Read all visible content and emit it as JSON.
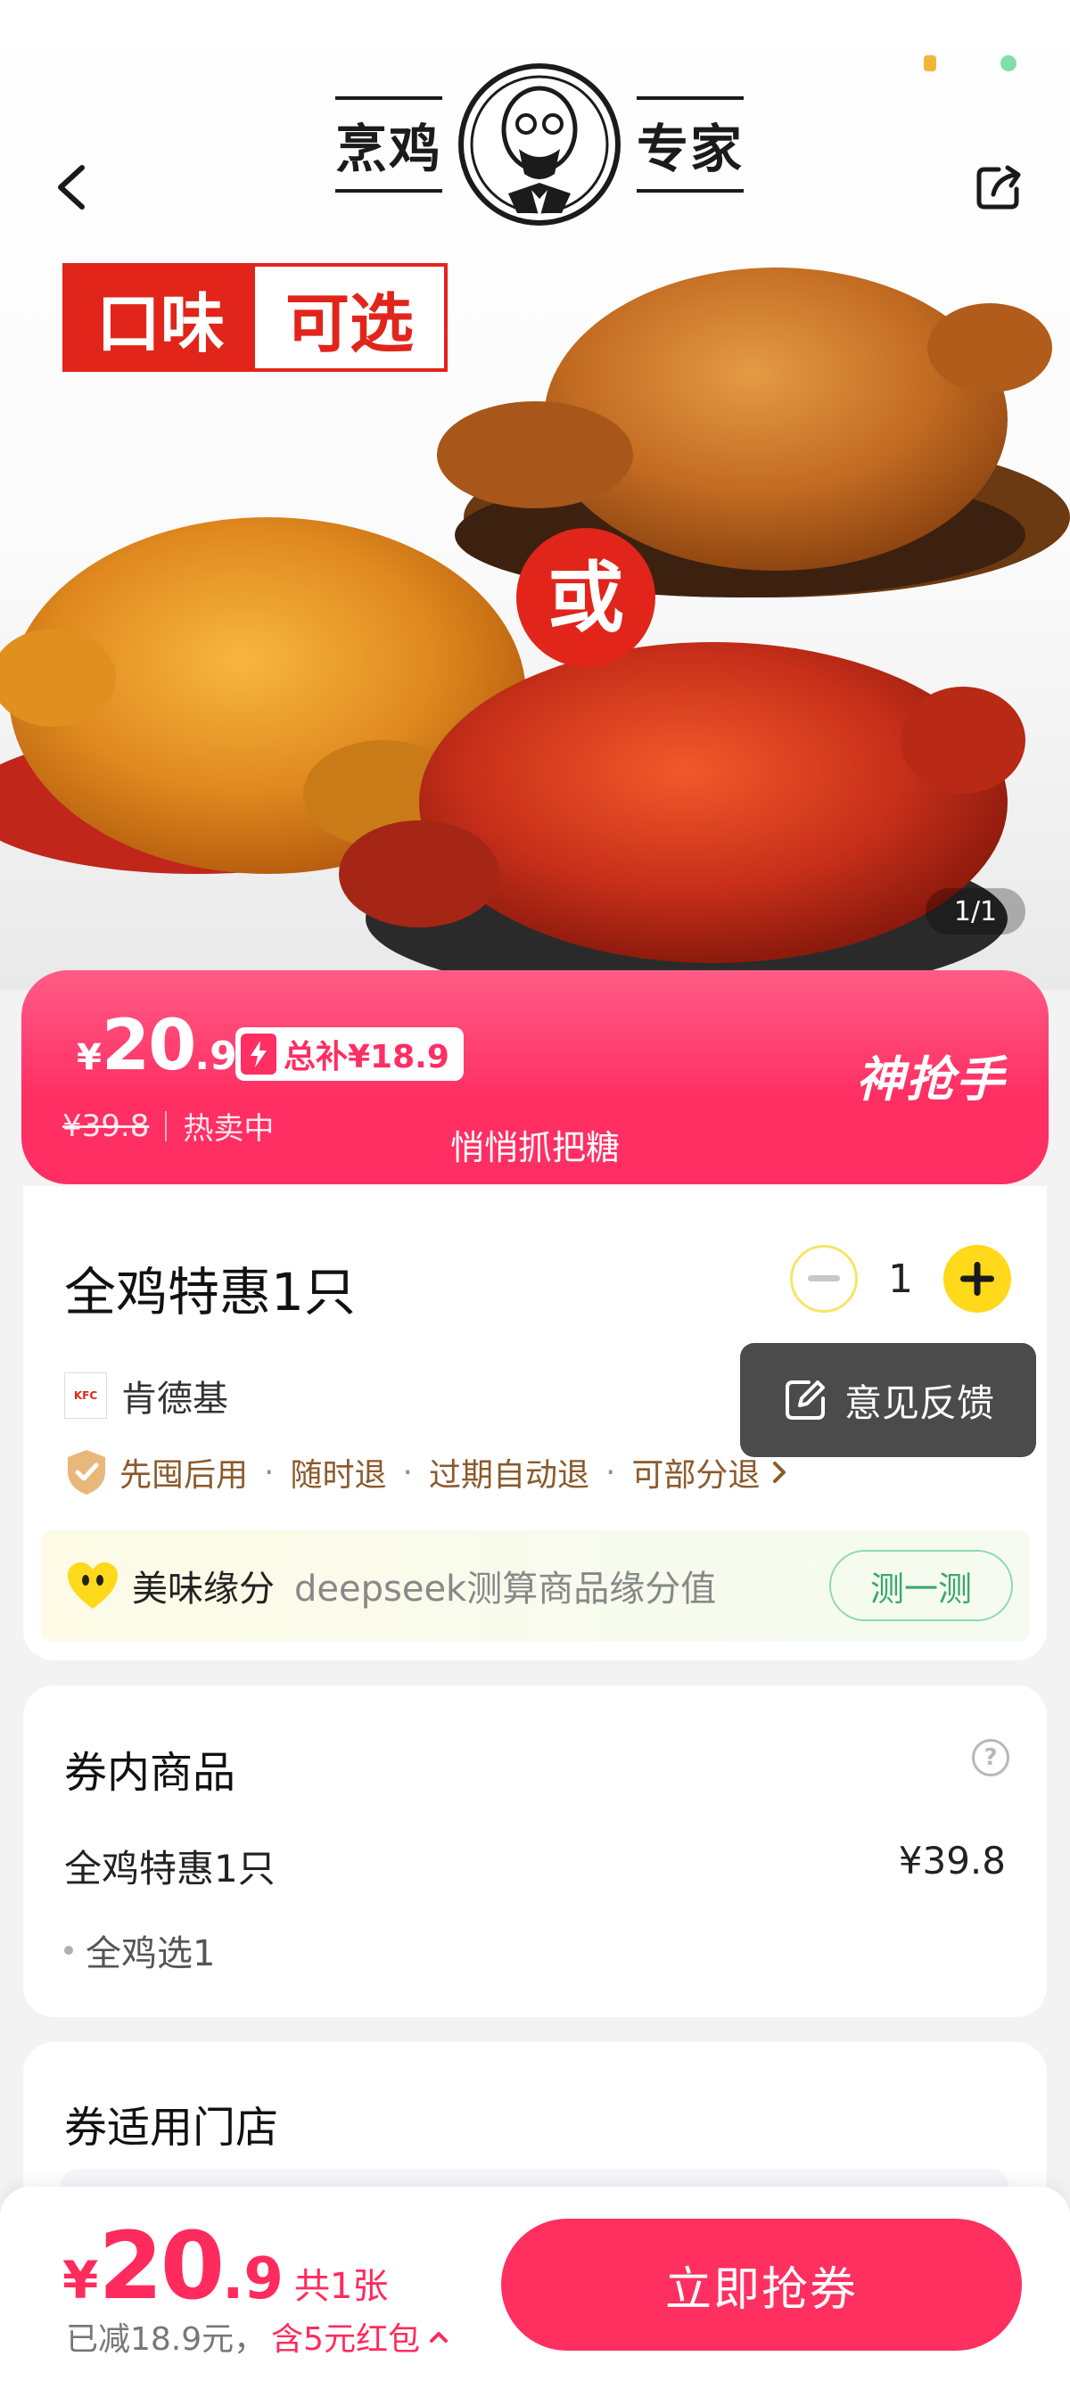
{
  "header": {
    "logo_left_text": "烹鸡",
    "logo_right_text": "专家",
    "flavor_tag": [
      "口味",
      "可选"
    ],
    "or_label": "或",
    "page_counter": "1/1"
  },
  "promo": {
    "currency": "¥",
    "price_int": "20",
    "price_dec": ".9",
    "subsidy": "总补¥18.9",
    "original_price": "¥39.8",
    "status": "热卖中",
    "slogan": "悄悄抓把糖",
    "brand": "神抢手"
  },
  "product": {
    "title": "全鸡特惠1只",
    "quantity": "1",
    "merchant": "肯德基",
    "merchant_logo_text": "KFC",
    "guarantees": [
      "先囤后用",
      "随时退",
      "过期自动退",
      "可部分退"
    ],
    "feedback_label": "意见反馈"
  },
  "yuanfen": {
    "title": "美味缘分",
    "desc": "deepseek测算商品缘分值",
    "button": "测一测"
  },
  "contents": {
    "title": "券内商品",
    "help": "?",
    "item_name": "全鸡特惠1只",
    "item_price": "¥39.8",
    "sub_item": "全鸡选1"
  },
  "stores": {
    "title": "券适用门店"
  },
  "bottom_bar": {
    "currency": "¥",
    "price_int": "20",
    "price_dec": ".9",
    "count": "共1张",
    "discount_note": "已减18.9元，",
    "red_packet": "含5元红包",
    "buy_label": "立即抢券"
  },
  "colors": {
    "accent": "#ff2e63",
    "yellow": "#ffd91a",
    "kfc_red": "#e1251b",
    "green": "#3aa86b"
  },
  "icons": [
    "back-icon",
    "share-icon",
    "minus-icon",
    "plus-icon",
    "feedback-icon",
    "shield-check-icon",
    "heart-face-icon",
    "help-icon",
    "chevron-right-icon",
    "chevron-up-icon",
    "bolt-icon"
  ]
}
